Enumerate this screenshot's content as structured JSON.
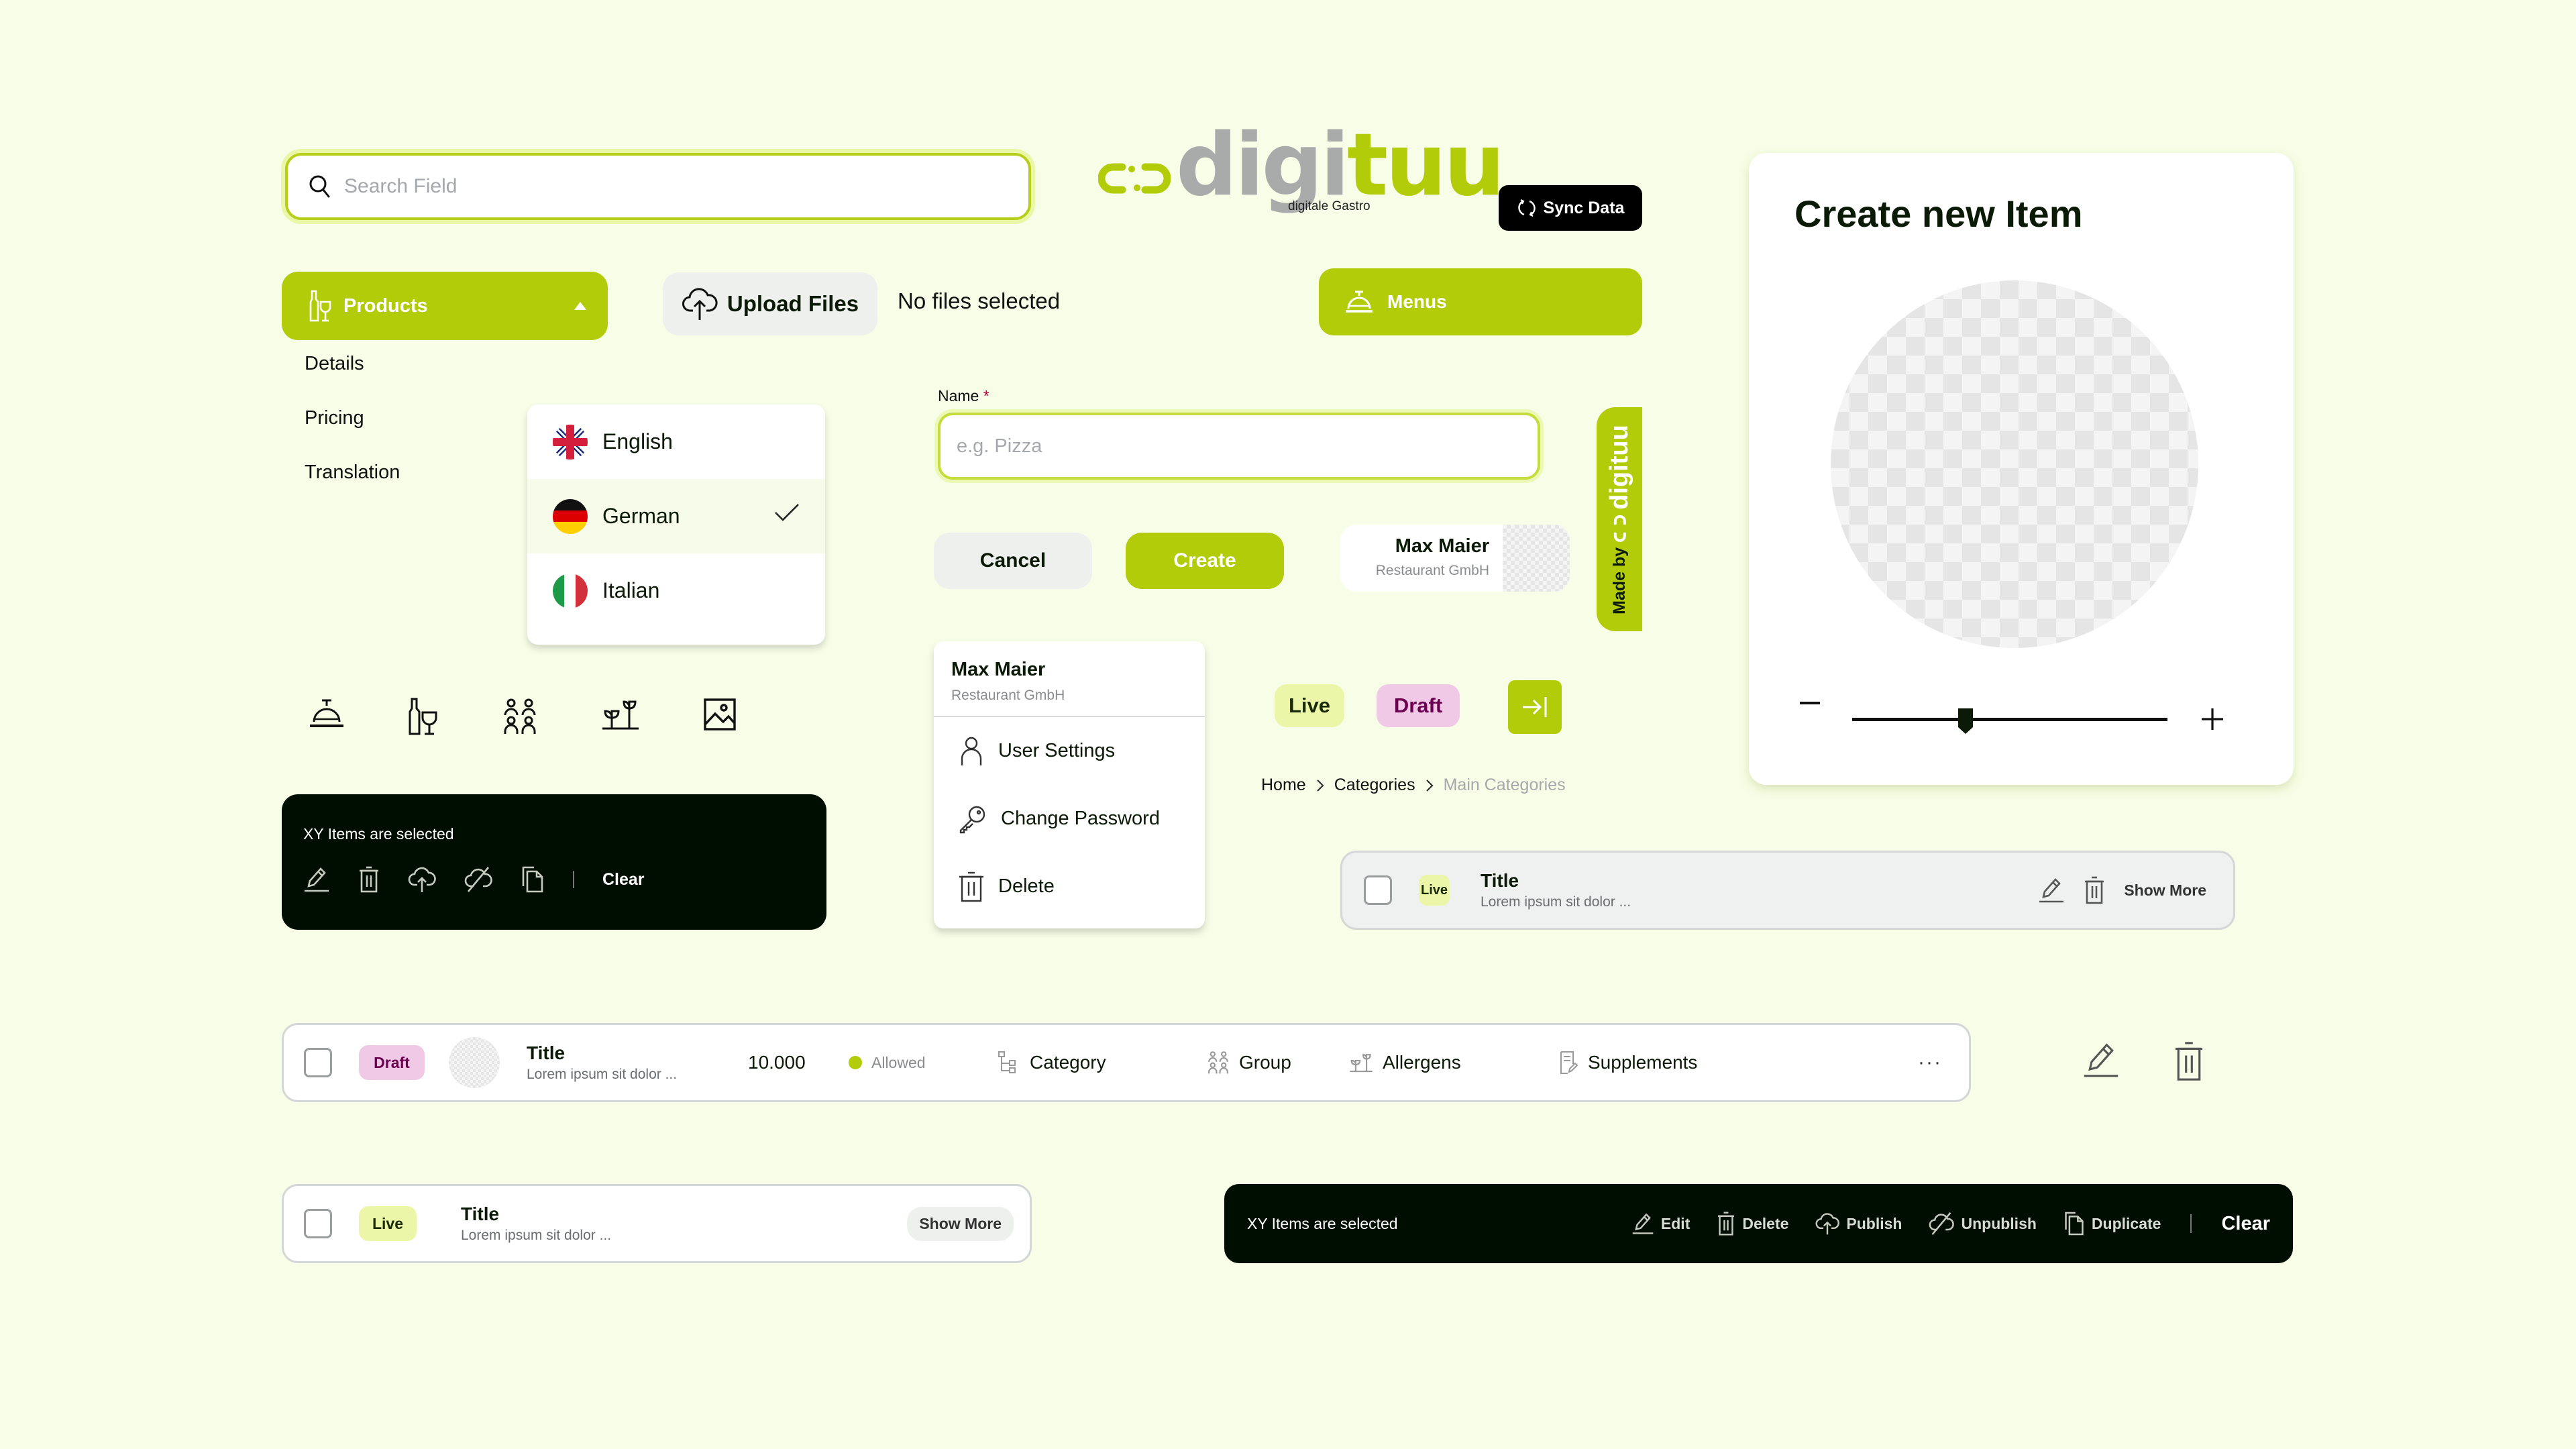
{
  "colors": {
    "background": "#f7fde6",
    "accent": "#b3cc0a",
    "dark": "#000e02",
    "live_badge": "#ecf6a8",
    "draft_badge": "#efc9e6",
    "draft_text": "#6c0050",
    "required": "#b0003a"
  },
  "search": {
    "placeholder": "Search Field",
    "value": ""
  },
  "logo": {
    "word_gray": "digi",
    "word_green": "tuu",
    "subtitle": "digitale Gastro"
  },
  "sync_button": {
    "label": "Sync Data",
    "icon": "sync-icon"
  },
  "products_menu": {
    "label": "Products",
    "icon": "bottle-glass-icon",
    "expanded": true,
    "items": [
      {
        "label": "Details"
      },
      {
        "label": "Pricing"
      },
      {
        "label": "Translation"
      }
    ]
  },
  "upload": {
    "button_label": "Upload Files",
    "status": "No files selected",
    "icon": "cloud-upload-icon"
  },
  "menus_button": {
    "label": "Menus",
    "icon": "service-bell-icon"
  },
  "language_dropdown": {
    "options": [
      {
        "label": "English",
        "flag": "uk-flag-icon",
        "selected": false
      },
      {
        "label": "German",
        "flag": "germany-flag-icon",
        "selected": true
      },
      {
        "label": "Italian",
        "flag": "italy-flag-icon",
        "selected": false
      }
    ]
  },
  "name_field": {
    "label": "Name",
    "required_mark": "*",
    "placeholder": "e.g. Pizza",
    "value": ""
  },
  "form_buttons": {
    "cancel": "Cancel",
    "create": "Create"
  },
  "user": {
    "name": "Max Maier",
    "company": "Restaurant GmbH"
  },
  "made_by": {
    "prefix": "Made by",
    "brand": "digituu"
  },
  "create_card": {
    "title": "Create new Item",
    "zoom_minus": "−",
    "zoom_plus": "+",
    "zoom_level": 0.36
  },
  "icon_row": [
    "service-bell-icon",
    "bottle-glass-icon",
    "group-icon",
    "allergens-plant-icon",
    "image-icon"
  ],
  "selection_bar_compact": {
    "count_text": "XY Items are selected",
    "actions": [
      "edit-icon",
      "delete-icon",
      "publish-icon",
      "unpublish-icon",
      "duplicate-icon"
    ],
    "clear_label": "Clear"
  },
  "profile_menu": {
    "name": "Max Maier",
    "company": "Restaurant GmbH",
    "items": [
      {
        "label": "User Settings",
        "icon": "user-icon"
      },
      {
        "label": "Change Password",
        "icon": "key-icon"
      },
      {
        "label": "Delete",
        "icon": "trash-icon"
      }
    ]
  },
  "badges": {
    "live": "Live",
    "draft": "Draft"
  },
  "collapse_button": {
    "icon": "arrow-to-right-icon"
  },
  "breadcrumb": {
    "items": [
      "Home",
      "Categories",
      "Main Categories"
    ]
  },
  "row_compact": {
    "status": "Live",
    "title": "Title",
    "description": "Lorem ipsum sit dolor ...",
    "show_more": "Show More"
  },
  "row_product": {
    "status": "Draft",
    "title": "Title",
    "description": "Lorem ipsum sit dolor ...",
    "price": "10.000",
    "availability": "Allowed",
    "category": "Category",
    "group": "Group",
    "allergens": "Allergens",
    "supplements": "Supplements",
    "more": "···"
  },
  "row_simple": {
    "status": "Live",
    "title": "Title",
    "description": "Lorem ipsum sit dolor ...",
    "show_more": "Show More"
  },
  "selection_bar_full": {
    "count_text": "XY Items are selected",
    "actions": [
      {
        "label": "Edit",
        "icon": "edit-icon"
      },
      {
        "label": "Delete",
        "icon": "delete-icon"
      },
      {
        "label": "Publish",
        "icon": "publish-icon"
      },
      {
        "label": "Unpublish",
        "icon": "unpublish-icon"
      },
      {
        "label": "Duplicate",
        "icon": "duplicate-icon"
      }
    ],
    "clear_label": "Clear"
  }
}
